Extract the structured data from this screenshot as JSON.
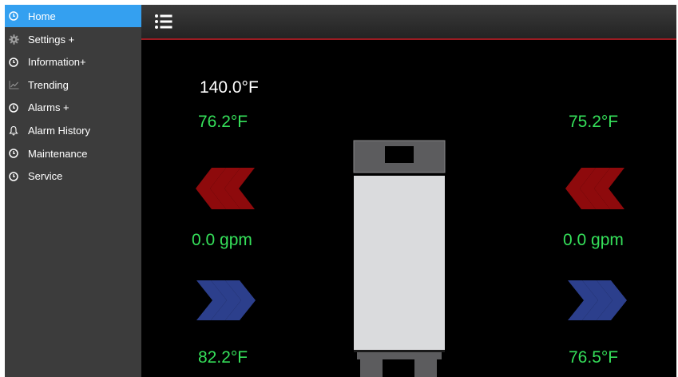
{
  "sidebar": {
    "items": [
      {
        "label": "Home",
        "icon": "clock-icon",
        "active": true
      },
      {
        "label": "Settings +",
        "icon": "gear-icon"
      },
      {
        "label": "Information+",
        "icon": "clock-icon"
      },
      {
        "label": "Trending",
        "icon": "chart-icon"
      },
      {
        "label": "Alarms +",
        "icon": "clock-icon"
      },
      {
        "label": "Alarm History",
        "icon": "bell-icon"
      },
      {
        "label": "Maintenance",
        "icon": "clock-icon"
      },
      {
        "label": "Service",
        "icon": "clock-icon"
      }
    ]
  },
  "header": {
    "menu_icon": "list-menu-icon"
  },
  "main": {
    "setpoint_temp": "140.0°F",
    "left_hot_temp": "76.2°F",
    "right_hot_temp": "75.2°F",
    "left_flow": "0.0 gpm",
    "right_flow": "0.0 gpm",
    "left_cold_temp": "82.2°F",
    "right_cold_temp": "76.5°F"
  },
  "colors": {
    "active_nav": "#34a0f0",
    "reading_green": "#35e05a",
    "hot_arrow": "#8e0a0c",
    "cold_arrow": "#2c3f8c",
    "header_border": "#9b1b21"
  }
}
